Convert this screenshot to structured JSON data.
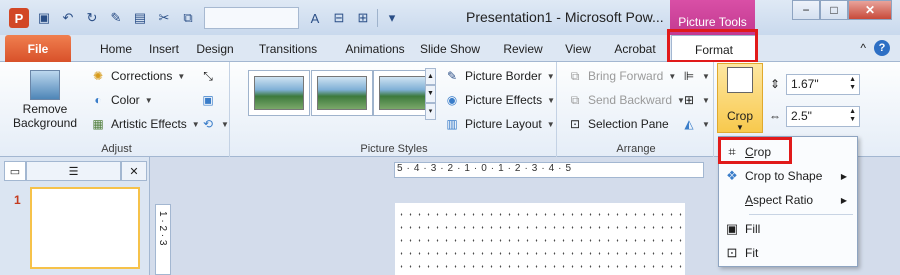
{
  "window": {
    "app_icon": "P",
    "title": "Presentation1 - Microsoft Pow...",
    "context_tab": "Picture Tools",
    "controls": {
      "minimize": "−",
      "maximize": "□",
      "close": "✕"
    }
  },
  "qat": {
    "icons": [
      "save-icon",
      "undo-icon",
      "redo-icon",
      "format-painter-icon",
      "paste-icon",
      "cut-icon",
      "copy-icon",
      "font-color-icon",
      "align-icon",
      "group-icon"
    ]
  },
  "tabs": [
    "File",
    "Home",
    "Insert",
    "Design",
    "Transitions",
    "Animations",
    "Slide Show",
    "Review",
    "View",
    "Acrobat",
    "Format"
  ],
  "active_tab": "Format",
  "help": {
    "caret": "^",
    "question": "?"
  },
  "ribbon": {
    "adjust": {
      "remove_background": "Remove Background",
      "corrections": "Corrections",
      "color": "Color",
      "artistic_effects": "Artistic Effects",
      "label": "Adjust"
    },
    "styles": {
      "label": "Picture Styles",
      "picture_border": "Picture Border",
      "picture_effects": "Picture Effects",
      "picture_layout": "Picture Layout"
    },
    "arrange": {
      "label": "Arrange",
      "bring_forward": "Bring Forward",
      "send_backward": "Send Backward",
      "selection_pane": "Selection Pane"
    },
    "size": {
      "crop": "Crop",
      "height": "1.67\"",
      "width": "2.5\""
    }
  },
  "left_pane": {
    "slide_number": "1",
    "close": "✕"
  },
  "ruler": {
    "text": "5 · 4 · 3 · 2 · 1 · 0 · 1 · 2 · 3 · 4 · 5",
    "vertical": "1 · 2 · 3"
  },
  "menu": {
    "items": [
      {
        "label": "Crop",
        "key": "C",
        "rest": "rop",
        "icon": "crop-icon"
      },
      {
        "label": "Crop to Shape",
        "key": "",
        "rest": "",
        "icon": "shape-icon",
        "submenu": true
      },
      {
        "label": "Aspect Ratio",
        "key": "A",
        "rest": "spect Ratio",
        "icon": "",
        "submenu": true
      },
      {
        "label": "Fill",
        "key": "",
        "rest": "",
        "icon": "fill-icon"
      },
      {
        "label": "Fit",
        "key": "",
        "rest": "",
        "icon": "fit-icon"
      }
    ]
  },
  "colors": {
    "highlight_box": "#e11a1a",
    "file_tab": "#d8512a",
    "context_tab": "#c23a91",
    "crop_active": "#f8c94d"
  }
}
